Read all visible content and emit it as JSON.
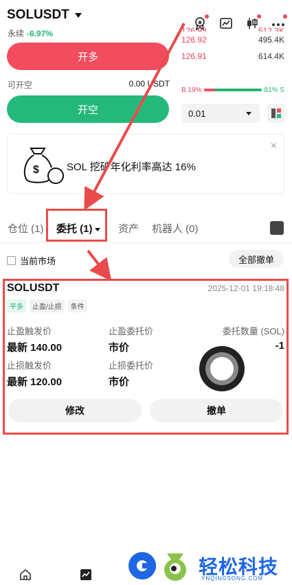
{
  "header": {
    "symbol": "SOLUSDT",
    "perpetual_label": "永续",
    "change_pct": "-6.97%"
  },
  "trade": {
    "long_label": "开多",
    "open_short_label": "可开空",
    "open_short_value": "0.00 USDT",
    "short_label": "开空",
    "quantity_value": "0.01"
  },
  "orderbook": {
    "rows": [
      {
        "price": "126.92",
        "qty": "495.4K"
      },
      {
        "price": "126.91",
        "qty": "614.4K"
      }
    ],
    "buy_pct": 19,
    "buy_label": "B 19%",
    "sell_label": "81% S"
  },
  "promo": {
    "text": "SOL 挖矿年化利率高达 16%",
    "close": "×"
  },
  "tabs": [
    {
      "label": "仓位 (1)"
    },
    {
      "label": "委托 (1)"
    },
    {
      "label": "资产"
    },
    {
      "label": "机器人 (0)"
    }
  ],
  "filter": {
    "current_market": "当前市场",
    "cancel_all": "全部撤单"
  },
  "order": {
    "symbol": "SOLUSDT",
    "time": "2025-12-01 19:18:48",
    "tags": [
      "平多",
      "止盈/止损",
      "条件"
    ],
    "tp_trigger_label": "止盈触发价",
    "tp_trigger_value": "最新 140.00",
    "tp_order_label": "止盈委托价",
    "tp_order_value": "市价",
    "qty_label": "委托数量 (SOL)",
    "qty_value": "-1",
    "sl_trigger_label": "止损触发价",
    "sl_trigger_value": "最新 120.00",
    "sl_order_label": "止损委托价",
    "sl_order_value": "市价",
    "modify_label": "修改",
    "cancel_label": "撤单"
  },
  "watermark": {
    "text": "轻松科技",
    "sub": "YNQINGSONG.COM"
  },
  "colors": {
    "red": "#f24c5e",
    "green": "#24b97a",
    "annotation": "#e94b4b",
    "watermark": "#1e66e6"
  }
}
